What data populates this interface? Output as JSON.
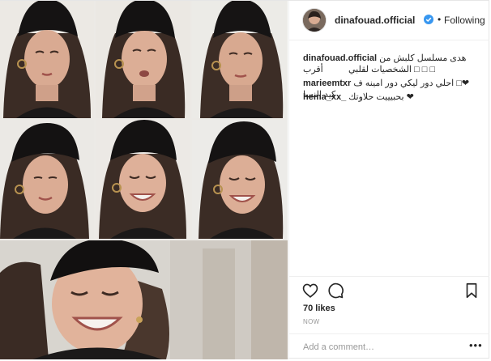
{
  "post": {
    "username": "dinafouad.official",
    "separator": "•",
    "follow_label": "Following",
    "caption_user": "dinafouad.official",
    "caption_text": "هدى مسلسل كلبش من أقرب",
    "caption_line2": "□ □ □ الشخصيات لقلبي",
    "comments": [
      {
        "user": "marieemtxr",
        "text": "❤□ احلي دور ليكي دور امينه ف كيد النسا"
      },
      {
        "user": "hema_xx_",
        "text": "❤ بحبيييت حلاوتك"
      }
    ],
    "likes": "70 likes",
    "time": "NOW",
    "add_comment_placeholder": "Add a comment…",
    "more": "•••"
  },
  "colors": {
    "verified": "#3897f0",
    "text": "#262626",
    "muted": "#999999",
    "border": "#efefef"
  },
  "icons": [
    "heart-icon",
    "comment-icon",
    "bookmark-icon",
    "verified-badge-icon",
    "more-options-icon"
  ]
}
